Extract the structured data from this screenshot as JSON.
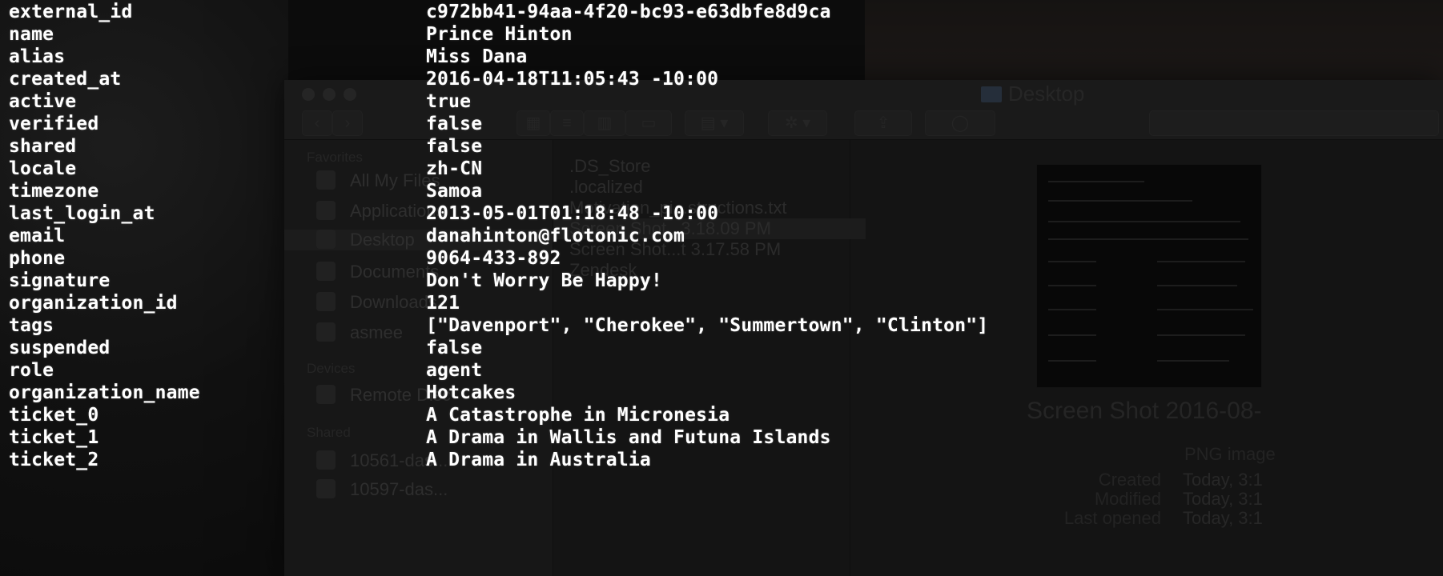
{
  "record": {
    "fields": [
      {
        "key": "external_id",
        "value": "c972bb41-94aa-4f20-bc93-e63dbfe8d9ca"
      },
      {
        "key": "name",
        "value": "Prince Hinton"
      },
      {
        "key": "alias",
        "value": "Miss Dana"
      },
      {
        "key": "created_at",
        "value": "2016-04-18T11:05:43 -10:00"
      },
      {
        "key": "active",
        "value": "true"
      },
      {
        "key": "verified",
        "value": "false"
      },
      {
        "key": "shared",
        "value": "false"
      },
      {
        "key": "locale",
        "value": "zh-CN"
      },
      {
        "key": "timezone",
        "value": "Samoa"
      },
      {
        "key": "last_login_at",
        "value": "2013-05-01T01:18:48 -10:00"
      },
      {
        "key": "email",
        "value": "danahinton@flotonic.com"
      },
      {
        "key": "phone",
        "value": "9064-433-892"
      },
      {
        "key": "signature",
        "value": "Don't Worry Be Happy!"
      },
      {
        "key": "organization_id",
        "value": "121"
      },
      {
        "key": "tags",
        "value": "[\"Davenport\", \"Cherokee\", \"Summertown\", \"Clinton\"]"
      },
      {
        "key": "suspended",
        "value": "false"
      },
      {
        "key": "role",
        "value": "agent"
      },
      {
        "key": "organization_name",
        "value": "Hotcakes"
      },
      {
        "key": "ticket_0",
        "value": "A Catastrophe in Micronesia"
      },
      {
        "key": "ticket_1",
        "value": "A Drama in Wallis and Futuna Islands"
      },
      {
        "key": "ticket_2",
        "value": "A Drama in Australia"
      }
    ]
  },
  "finder": {
    "window_title": "Desktop",
    "sidebar": {
      "favorites_header": "Favorites",
      "favorites": [
        "All My Files",
        "Applications",
        "Desktop",
        "Documents",
        "Downloads",
        "asmee"
      ],
      "devices_header": "Devices",
      "devices": [
        "Remote Disc"
      ],
      "shared_header": "Shared",
      "shared": [
        "10561-das...",
        "10597-das..."
      ]
    },
    "files": [
      ".DS_Store",
      ".localized",
      "Motivation_pi...structions.txt",
      "Screen Shot...3.18.09 PM",
      "Screen Shot...t 3.17.58 PM",
      "Zendesk"
    ],
    "preview": {
      "name": "Screen Shot 2016-08-",
      "type": "PNG image",
      "created_label": "Created",
      "created_value": "Today, 3:1",
      "modified_label": "Modified",
      "modified_value": "Today, 3:1",
      "opened_label": "Last opened",
      "opened_value": "Today, 3:1"
    }
  },
  "colors": {
    "background": "#0c0c0c",
    "text": "#ffffff",
    "dimmed_window": "#1b1b1b"
  }
}
